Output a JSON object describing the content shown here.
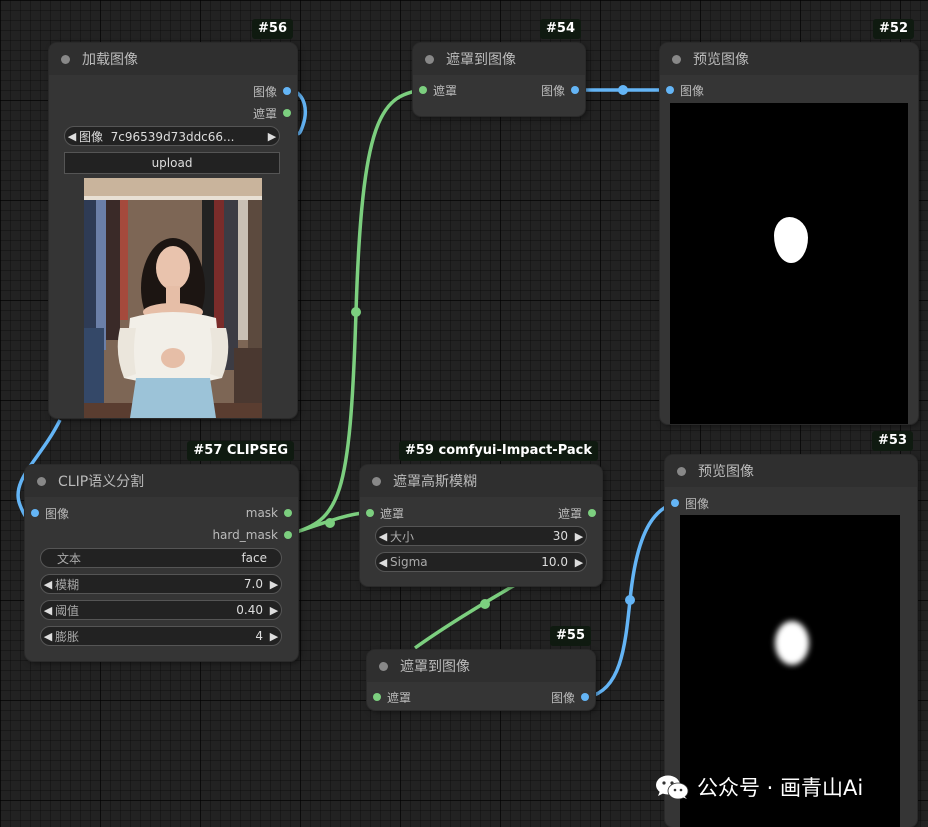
{
  "colors": {
    "canvas": "#222222",
    "node_body": "#353535",
    "node_header": "#2f2f2f",
    "image_link": "#64b5f6",
    "mask_link": "#7ccf7f"
  },
  "nodes": {
    "load_image": {
      "id": "#56",
      "title": "加载图像",
      "outputs": [
        "图像",
        "遮罩"
      ],
      "image_widget": {
        "label": "图像",
        "value": "7c96539d73ddc66..."
      },
      "upload_label": "upload"
    },
    "mask_to_image_top": {
      "id": "#54",
      "title": "遮罩到图像",
      "input": "遮罩",
      "output": "图像"
    },
    "preview_top": {
      "id": "#52",
      "title": "预览图像",
      "input": "图像"
    },
    "clipseg": {
      "id": "#57 CLIPSEG",
      "title": "CLIP语义分割",
      "input": "图像",
      "outputs": [
        "mask",
        "hard_mask"
      ],
      "text_widget": {
        "label": "文本",
        "value": "face"
      },
      "widgets": [
        {
          "label": "模糊",
          "value": "7.0"
        },
        {
          "label": "阈值",
          "value": "0.40"
        },
        {
          "label": "膨胀",
          "value": "4"
        }
      ]
    },
    "gaussian_blur": {
      "id": "#59 comfyui-Impact-Pack",
      "title": "遮罩高斯模糊",
      "input": "遮罩",
      "output": "遮罩",
      "widgets": [
        {
          "label": "大小",
          "value": "30"
        },
        {
          "label": "Sigma",
          "value": "10.0"
        }
      ]
    },
    "mask_to_image_bottom": {
      "id": "#55",
      "title": "遮罩到图像",
      "input": "遮罩",
      "output": "图像"
    },
    "preview_bottom": {
      "id": "#53",
      "title": "预览图像",
      "input": "图像"
    }
  },
  "watermark": {
    "text": "公众号 · 画青山Ai"
  }
}
